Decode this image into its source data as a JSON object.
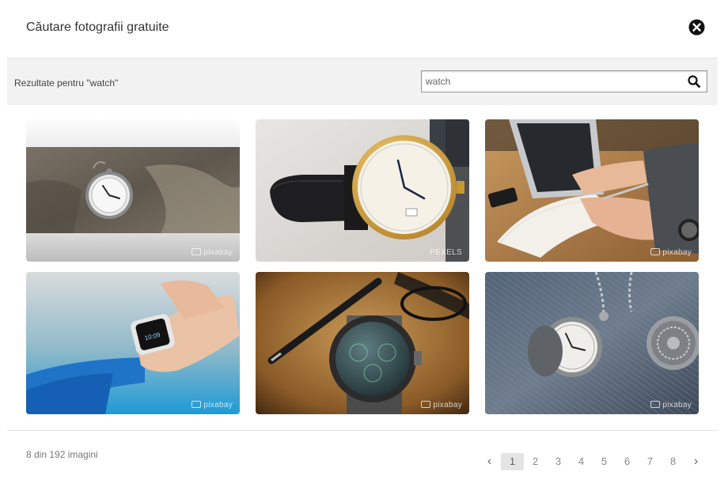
{
  "dialog": {
    "title": "Căutare fotografii gratuite"
  },
  "toolbar": {
    "results_label": "Rezultate pentru \"watch\"",
    "search_value": "watch"
  },
  "images": [
    {
      "description": "pocket-watch-on-sand",
      "watermark": "pixabay"
    },
    {
      "description": "gold-wristwatch-leather-strap",
      "watermark": "PEXELS"
    },
    {
      "description": "person-writing-notebook-laptop",
      "watermark": "pixabay"
    },
    {
      "description": "smartwatch-on-wrist",
      "watermark": "pixabay"
    },
    {
      "description": "chronograph-watch-and-pen",
      "watermark": "pixabay"
    },
    {
      "description": "pocket-watches-on-denim",
      "watermark": "pixabay"
    }
  ],
  "footer": {
    "count_text": "8 din 192 imagini",
    "prev_label": "‹",
    "next_label": "›",
    "pages": [
      "1",
      "2",
      "3",
      "4",
      "5",
      "6",
      "7",
      "8"
    ],
    "active_page": "1"
  }
}
